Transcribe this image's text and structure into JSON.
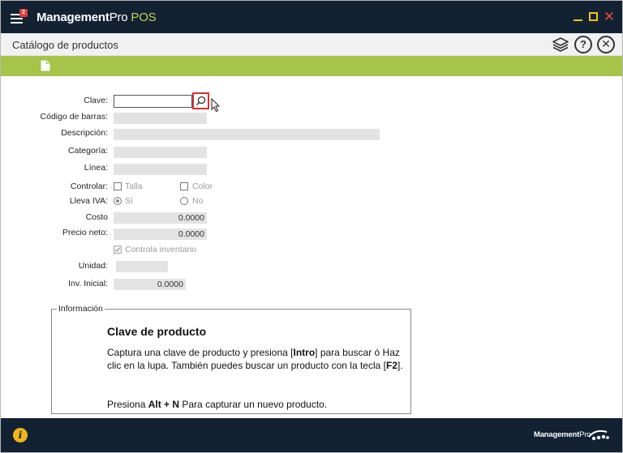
{
  "app": {
    "name_bold": "Management",
    "name_regular": "Pro",
    "name_suffix": " POS",
    "notification_count": "2"
  },
  "page": {
    "title": "Catálogo de productos"
  },
  "form": {
    "clave_label": "Clave:",
    "clave_value": "",
    "codigo_barras_label": "Código de barras:",
    "descripcion_label": "Descripción:",
    "categoria_label": "Categoría:",
    "linea_label": "Línea:",
    "controlar_label": "Controlar:",
    "talla_label": "Talla",
    "color_label": "Color",
    "lleva_iva_label": "Lleva IVA:",
    "si_label": "Sí",
    "no_label": "No",
    "costo_label": "Costo",
    "costo_value": "0.0000",
    "precio_neto_label": "Precio neto:",
    "precio_neto_value": "0.0000",
    "controla_inventario_label": "Controla inventario",
    "unidad_label": "Unidad:",
    "inv_inicial_label": "Inv. Inicial:",
    "inv_inicial_value": "0.0000"
  },
  "info": {
    "legend": "Información",
    "title": "Clave de producto",
    "p1_a": "Captura una clave de producto y presiona [",
    "p1_key": "Intro",
    "p1_b": "] para buscar ó Haz clic en la lupa.  También puedes buscar un producto con la tecla [",
    "p1_key2": "F2",
    "p1_c": "].",
    "p2_a": "Presiona ",
    "p2_key": "Alt + N",
    "p2_b": " Para capturar un nuevo producto."
  },
  "footer": {
    "brand_bold": "Management",
    "brand_regular": "Pro"
  },
  "colors": {
    "titlebar": "#122233",
    "accent_green": "#a6c34a",
    "window_controls": "#f2c318",
    "close": "#e94a3a"
  }
}
